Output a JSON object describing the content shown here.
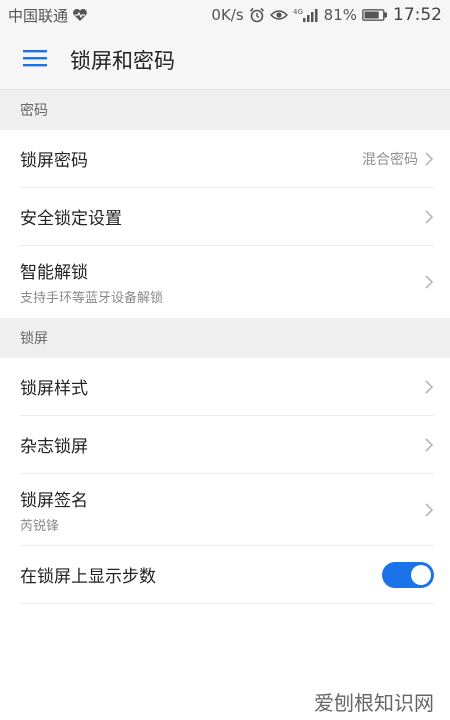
{
  "status_bar": {
    "carrier": "中国联通",
    "network_speed": "0K/s",
    "signal_type": "4G",
    "battery_percent": "81%",
    "battery_level": 0.81,
    "time": "17:52"
  },
  "header": {
    "title": "锁屏和密码"
  },
  "sections": {
    "password": {
      "header": "密码",
      "lock_password_label": "锁屏密码",
      "lock_password_value": "混合密码",
      "security_lock_label": "安全锁定设置",
      "smart_unlock_label": "智能解锁",
      "smart_unlock_sub": "支持手环等蓝牙设备解锁"
    },
    "lockscreen": {
      "header": "锁屏",
      "style_label": "锁屏样式",
      "magazine_label": "杂志锁屏",
      "signature_label": "锁屏签名",
      "signature_sub": "芮锐锋",
      "steps_label": "在锁屏上显示步数",
      "steps_enabled": true
    }
  },
  "watermark": "爱刨根知识网",
  "colors": {
    "accent": "#1a73e8",
    "section_bg": "#efefef"
  },
  "icons": {
    "menu": "hamburger-icon",
    "chevron": "chevron-right-icon",
    "heart": "heart-icon",
    "alarm": "alarm-icon",
    "eye": "eye-icon",
    "signal": "signal-icon",
    "battery": "battery-icon"
  }
}
